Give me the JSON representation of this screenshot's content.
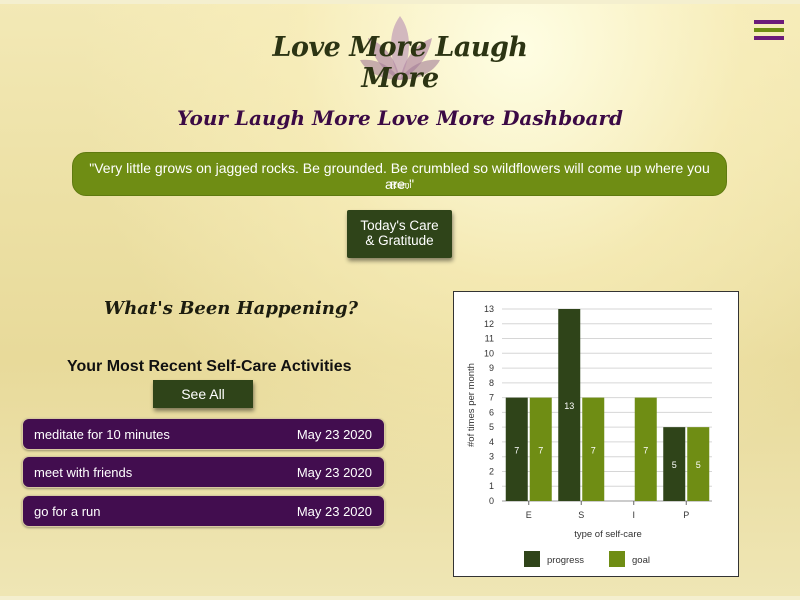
{
  "header": {
    "logo_text": "Love More Laugh More",
    "menu_icon": "hamburger-menu-icon",
    "menu_colors": [
      "#6b1a7a",
      "#6f8d14",
      "#6b1a7a"
    ]
  },
  "dashboard_title": "Your Laugh More Love More Dashboard",
  "quote": {
    "text": "\"Very little grows on jagged rocks. Be grounded. Be crumbled so wildflowers will come up where you are.\"",
    "author": "-Rumi"
  },
  "care_button": {
    "line1": "Today's Care",
    "line2": "& Gratitude"
  },
  "happening_title": "What's Been Happening?",
  "recent": {
    "title": "Your Most Recent Self-Care Activities",
    "see_all_label": "See All",
    "items": [
      {
        "name": "meditate for 10 minutes",
        "date": "May 23 2020"
      },
      {
        "name": "meet with friends",
        "date": "May 23 2020"
      },
      {
        "name": "go for a run",
        "date": "May 23 2020"
      }
    ]
  },
  "colors": {
    "accent_green": "#6f8d14",
    "dark_green": "#2f4419",
    "purple": "#420d4f",
    "title_purple": "#3b0a45"
  },
  "chart_data": {
    "type": "bar",
    "categories": [
      "E",
      "S",
      "I",
      "P"
    ],
    "series": [
      {
        "name": "progress",
        "values": [
          7,
          13,
          0,
          5
        ],
        "labels": [
          "7",
          "13",
          "",
          "5"
        ],
        "color": "#2f4419"
      },
      {
        "name": "goal",
        "values": [
          7,
          7,
          7,
          5
        ],
        "labels": [
          "7",
          "7",
          "7",
          "5"
        ],
        "color": "#6f8d14"
      }
    ],
    "xlabel": "type of self-care",
    "ylabel": "#of times per month",
    "ylim": [
      0,
      13
    ],
    "yticks": [
      0,
      1,
      2,
      3,
      4,
      5,
      6,
      7,
      8,
      9,
      10,
      11,
      12,
      13
    ],
    "grid": true,
    "legend_position": "bottom"
  }
}
